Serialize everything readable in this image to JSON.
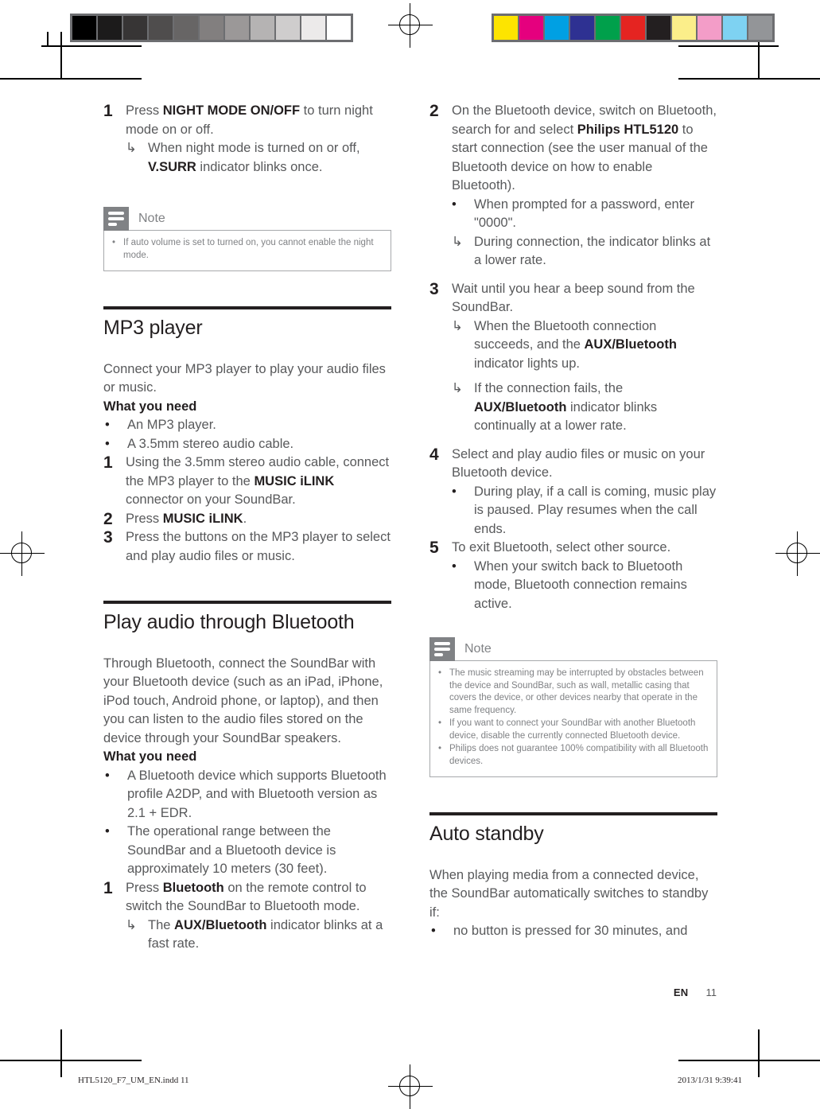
{
  "page": {
    "language_code": "EN",
    "page_number": "11",
    "print_filename": "HTL5120_F7_UM_EN.indd   11",
    "print_timestamp": "2013/1/31   9:39:41"
  },
  "calibration": {
    "grayscale_label": "grayscale-step-wedge",
    "grayscale_swatches": [
      "#000000",
      "#1c1b1b",
      "#373535",
      "#4f4d4d",
      "#676565",
      "#827f7f",
      "#9b9898",
      "#b5b3b3",
      "#cfcdcd",
      "#eceaea",
      "#ffffff"
    ],
    "color_label": "cmyk-color-bar",
    "color_swatches": [
      "#fde400",
      "#e5007e",
      "#00a0e3",
      "#2e3192",
      "#00a04b",
      "#e52421",
      "#231f20",
      "#fbee8a",
      "#f39dc8",
      "#7ed2f2",
      "#939598"
    ]
  },
  "left_column": {
    "step_1": {
      "marker": "1",
      "text_before_bold": "Press ",
      "bold": "NIGHT MODE ON/OFF",
      "text_after_bold": " to turn night mode on or off.",
      "arrow_result": {
        "marker": "↳",
        "text_before_bold": "When night mode is turned on or off, ",
        "bold": "V.SURR",
        "text_after_bold": " indicator blinks once."
      }
    },
    "note_1": {
      "icon": "note-icon",
      "title": "Note",
      "items": [
        {
          "marker": "•",
          "text": "If auto volume is set to turned on, you cannot enable the night mode."
        }
      ]
    },
    "mp3_section": {
      "title": "MP3 player",
      "intro": "Connect your MP3 player to play your audio files or music.",
      "what_you_need_label": "What you need",
      "requirements": [
        {
          "marker": "•",
          "text": "An MP3 player."
        },
        {
          "marker": "•",
          "text": "A 3.5mm stereo audio cable."
        }
      ],
      "steps": [
        {
          "marker": "1",
          "text_before_bold": "Using the 3.5mm stereo audio cable, connect the MP3 player to the ",
          "bold": "MUSIC iLINK",
          "text_after_bold": " connector on your SoundBar."
        },
        {
          "marker": "2",
          "text_before_bold": "Press ",
          "bold": "MUSIC iLINK",
          "text_after_bold": "."
        },
        {
          "marker": "3",
          "text_before_bold": "Press the buttons on the MP3 player to select and play audio files or music.",
          "bold": "",
          "text_after_bold": ""
        }
      ]
    },
    "bluetooth_section": {
      "title": "Play audio through Bluetooth",
      "intro": "Through Bluetooth, connect the SoundBar with your Bluetooth device (such as an iPad, iPhone, iPod touch, Android phone, or laptop), and then you can listen to the audio files stored on the device through your SoundBar speakers.",
      "what_you_need_label": "What you need",
      "requirements": [
        {
          "marker": "•",
          "text": "A Bluetooth device which supports Bluetooth profile A2DP, and with Bluetooth version as 2.1 + EDR."
        },
        {
          "marker": "•",
          "text": "The operational range between the SoundBar and a Bluetooth device is approximately 10 meters (30 feet)."
        }
      ],
      "step_1": {
        "marker": "1",
        "text_before_bold": "Press ",
        "bold": "Bluetooth",
        "text_after_bold": " on the remote control to switch the SoundBar to Bluetooth mode.",
        "arrow_result": {
          "marker": "↳",
          "text_before_bold": "The ",
          "bold": "AUX/Bluetooth",
          "text_after_bold": " indicator blinks at a fast rate."
        }
      }
    }
  },
  "right_column": {
    "step_2": {
      "marker": "2",
      "text_before_bold": "On the Bluetooth device, switch on Bluetooth, search for and select ",
      "bold": "Philips HTL5120",
      "text_after_bold": " to start connection (see the user manual of the Bluetooth device on how to enable Bluetooth).",
      "sub_bullet": {
        "marker": "•",
        "text": "When prompted for a password, enter \"0000\"."
      },
      "arrow_result": {
        "marker": "↳",
        "text": "During connection, the indicator blinks at a lower rate."
      }
    },
    "step_3": {
      "marker": "3",
      "text": "Wait until you hear a beep sound from the SoundBar.",
      "arrow_results": [
        {
          "marker": "↳",
          "text_before_bold": "When the Bluetooth connection succeeds, and the ",
          "bold": "AUX/Bluetooth",
          "text_after_bold": " indicator lights up."
        },
        {
          "marker": "↳",
          "text_before_bold": "If the connection fails, the ",
          "bold": "AUX/Bluetooth",
          "text_after_bold": " indicator blinks continually at a lower rate."
        }
      ]
    },
    "step_4": {
      "marker": "4",
      "text": "Select and play audio files or music on your Bluetooth device.",
      "sub_bullet": {
        "marker": "•",
        "text": "During play, if a call is coming, music play is paused. Play resumes when the call ends."
      }
    },
    "step_5": {
      "marker": "5",
      "text": "To exit Bluetooth, select other source.",
      "sub_bullet": {
        "marker": "•",
        "text": "When your switch back to Bluetooth mode, Bluetooth connection remains active."
      }
    },
    "note_2": {
      "icon": "note-icon",
      "title": "Note",
      "items": [
        {
          "marker": "•",
          "text": "The music streaming may be interrupted by obstacles between the device and SoundBar, such as wall, metallic casing that covers the device, or other devices nearby that operate in the same frequency."
        },
        {
          "marker": "•",
          "text": "If you want to connect your SoundBar with another Bluetooth device, disable the currently connected Bluetooth device."
        },
        {
          "marker": "•",
          "text": "Philips does not guarantee 100% compatibility with all Bluetooth devices."
        }
      ]
    },
    "auto_standby_section": {
      "title": "Auto standby",
      "intro": "When playing media from a connected device, the SoundBar automatically switches to standby if:",
      "conditions": [
        {
          "marker": "•",
          "text": "no button is pressed for 30 minutes, and"
        }
      ]
    }
  }
}
